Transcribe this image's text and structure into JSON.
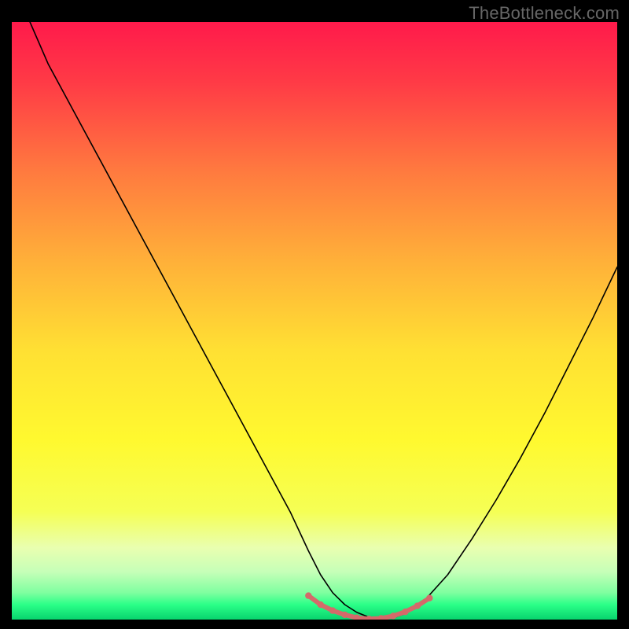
{
  "watermark": "TheBottleneck.com",
  "chart_data": {
    "type": "line",
    "title": "",
    "xlabel": "",
    "ylabel": "",
    "xlim": [
      0,
      100
    ],
    "ylim": [
      0,
      100
    ],
    "background_gradient": {
      "stops": [
        {
          "offset": 0.0,
          "color": "#ff1a4b"
        },
        {
          "offset": 0.1,
          "color": "#ff3a46"
        },
        {
          "offset": 0.25,
          "color": "#ff7a3f"
        },
        {
          "offset": 0.4,
          "color": "#ffb039"
        },
        {
          "offset": 0.55,
          "color": "#ffe033"
        },
        {
          "offset": 0.7,
          "color": "#fff92f"
        },
        {
          "offset": 0.82,
          "color": "#f5ff55"
        },
        {
          "offset": 0.88,
          "color": "#e9ffb0"
        },
        {
          "offset": 0.92,
          "color": "#c6ffb8"
        },
        {
          "offset": 0.955,
          "color": "#7fffa0"
        },
        {
          "offset": 0.975,
          "color": "#2bff88"
        },
        {
          "offset": 1.0,
          "color": "#08d46e"
        }
      ]
    },
    "series": [
      {
        "name": "bottleneck-curve",
        "stroke": "#000000",
        "stroke_width": 1.6,
        "x": [
          3,
          6,
          10,
          14,
          18,
          22,
          26,
          30,
          34,
          38,
          42,
          46,
          49,
          51,
          53,
          55,
          57,
          59,
          61,
          63,
          65,
          68,
          72,
          76,
          80,
          84,
          88,
          92,
          96,
          100
        ],
        "y": [
          100,
          93,
          85.5,
          78,
          70.5,
          63,
          55.5,
          48,
          40.5,
          33,
          25.5,
          18,
          11.5,
          7.5,
          4.5,
          2.5,
          1.2,
          0.4,
          0.1,
          0.3,
          1.0,
          3.0,
          7.5,
          13.5,
          20,
          27,
          34.5,
          42.5,
          50.5,
          59
        ]
      },
      {
        "name": "green-band-markers",
        "stroke": "#d46a6a",
        "stroke_width": 6,
        "marker_radius": 4.2,
        "x": [
          49,
          51,
          53,
          55,
          57,
          59,
          61,
          63,
          65,
          67,
          69
        ],
        "y": [
          4.0,
          2.5,
          1.5,
          0.8,
          0.3,
          0.1,
          0.2,
          0.6,
          1.3,
          2.3,
          3.6
        ]
      }
    ]
  }
}
